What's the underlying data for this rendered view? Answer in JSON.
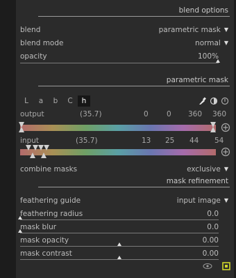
{
  "blend_options": {
    "section_title": "blend options",
    "blend": {
      "label": "blend",
      "value": "parametric mask"
    },
    "blend_mode": {
      "label": "blend mode",
      "value": "normal"
    },
    "opacity": {
      "label": "opacity",
      "value": "100%",
      "level": 1.0
    }
  },
  "parametric_mask": {
    "section_title": "parametric mask",
    "channels": [
      "L",
      "a",
      "b",
      "C",
      "h"
    ],
    "active_channel": "h",
    "output": {
      "label": "output",
      "picker": "(35.7)",
      "values": [
        "0",
        "0",
        "360",
        "360"
      ]
    },
    "input": {
      "label": "input",
      "picker": "(35.7)",
      "values": [
        "13",
        "25",
        "44",
        "54"
      ]
    },
    "combine_masks": {
      "label": "combine masks",
      "value": "exclusive"
    }
  },
  "mask_refinement": {
    "section_title": "mask refinement",
    "feathering_guide": {
      "label": "feathering guide",
      "value": "input image"
    },
    "feathering_radius": {
      "label": "feathering radius",
      "value": "0.0",
      "level": 0.0
    },
    "mask_blur": {
      "label": "mask blur",
      "value": "0.0",
      "level": 0.0
    },
    "mask_opacity": {
      "label": "mask opacity",
      "value": "0.00",
      "level": 0.5
    },
    "mask_contrast": {
      "label": "mask contrast",
      "value": "0.00",
      "level": 0.5
    }
  },
  "colors": {
    "panel_bg": "#2b2b2b",
    "outer_bg": "#1c1c1c",
    "text": "#bdbdbd",
    "active_toggle": "#cfd42a"
  },
  "icons": {
    "picker": "color-picker-icon",
    "invert": "invert-polarity-icon",
    "reset": "reset-icon",
    "add": "add-plus-circle-icon",
    "eye": "eye-icon",
    "toggle": "mask-toggle-icon"
  }
}
